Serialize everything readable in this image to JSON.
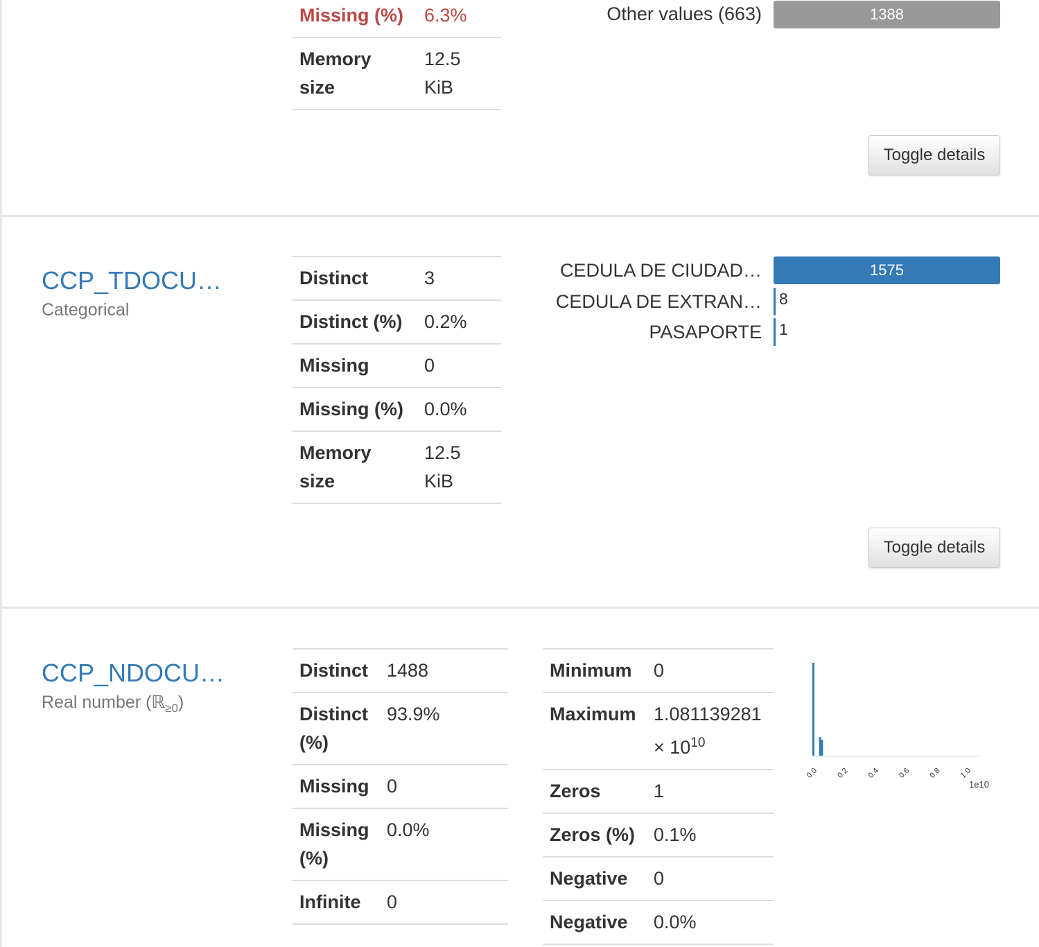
{
  "section_a": {
    "rows": [
      {
        "label": "Missing (%)",
        "value": "6.3%"
      },
      {
        "label": "Memory size",
        "value": "12.5 KiB"
      }
    ],
    "freq": [
      {
        "label": "Other values (663)",
        "count": "1388"
      }
    ],
    "toggle_label": "Toggle details"
  },
  "section_b": {
    "name": "CCP_TDOCU…",
    "type": "Categorical",
    "rows": [
      {
        "label": "Distinct",
        "value": "3"
      },
      {
        "label": "Distinct (%)",
        "value": "0.2%"
      },
      {
        "label": "Missing",
        "value": "0"
      },
      {
        "label": "Missing (%)",
        "value": "0.0%"
      },
      {
        "label": "Memory size",
        "value": "12.5 KiB"
      }
    ],
    "freq": [
      {
        "label": "CEDULA DE CIUDAD…",
        "count": "1575"
      },
      {
        "label": "CEDULA DE EXTRAN…",
        "count": "8"
      },
      {
        "label": "PASAPORTE",
        "count": "1"
      }
    ],
    "toggle_label": "Toggle details"
  },
  "section_c": {
    "name": "CCP_NDOCU…",
    "type_prefix": "Real number (ℝ",
    "type_sub": "≥0",
    "type_suffix": ")",
    "rows_left": [
      {
        "label": "Distinct",
        "value": "1488"
      },
      {
        "label": "Distinct (%)",
        "value": "93.9%"
      },
      {
        "label": "Missing",
        "value": "0"
      },
      {
        "label": "Missing (%)",
        "value": "0.0%"
      },
      {
        "label": "Infinite",
        "value": "0"
      }
    ],
    "rows_right": [
      {
        "label": "Minimum",
        "value": "0"
      },
      {
        "label": "Maximum",
        "value": "1.081139281 × 10",
        "sup": "10"
      },
      {
        "label": "Zeros",
        "value": "1"
      },
      {
        "label": "Zeros (%)",
        "value": "0.1%"
      },
      {
        "label": "Negative",
        "value": "0"
      },
      {
        "label": "Negative",
        "value": "0.0%"
      }
    ]
  },
  "chart_data": {
    "type": "bar",
    "x_tick_labels": [
      "0.0",
      "0.2",
      "0.4",
      "0.6",
      "0.8",
      "1.0"
    ],
    "x_multiplier_label": "1e10",
    "xlim": [
      0,
      1.0
    ],
    "bins": [
      {
        "x": 0.0,
        "height": 1.0
      },
      {
        "x": 0.044,
        "height": 0.2
      },
      {
        "x": 0.056,
        "height": 0.17
      }
    ],
    "colors": {
      "bar": "#337ab7",
      "axis": "#dddddd"
    }
  }
}
